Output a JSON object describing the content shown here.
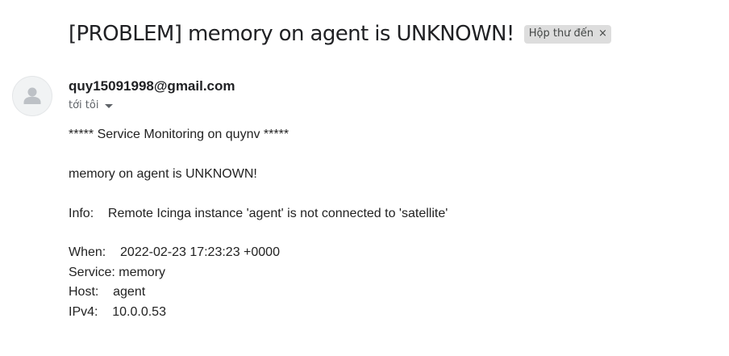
{
  "email": {
    "subject": "[PROBLEM] memory on agent is UNKNOWN!",
    "label": "Hộp thư đến",
    "label_close": "×",
    "sender": "quy15091998@gmail.com",
    "recipient": "tới tôi",
    "icons": {
      "avatar": "person-avatar-icon",
      "recipient_details": "caret-down-icon",
      "label_remove": "close-icon"
    }
  },
  "body": {
    "header_line": "***** Service Monitoring on quynv *****",
    "status_line": "memory on agent is UNKNOWN!",
    "info_line": "Info:    Remote Icinga instance 'agent' is not connected to 'satellite'",
    "when_line": "When:    2022-02-23 17:23:23 +0000",
    "service_line": "Service: memory",
    "host_line": "Host:    agent",
    "ipv4_line": "IPv4:    10.0.0.53"
  }
}
